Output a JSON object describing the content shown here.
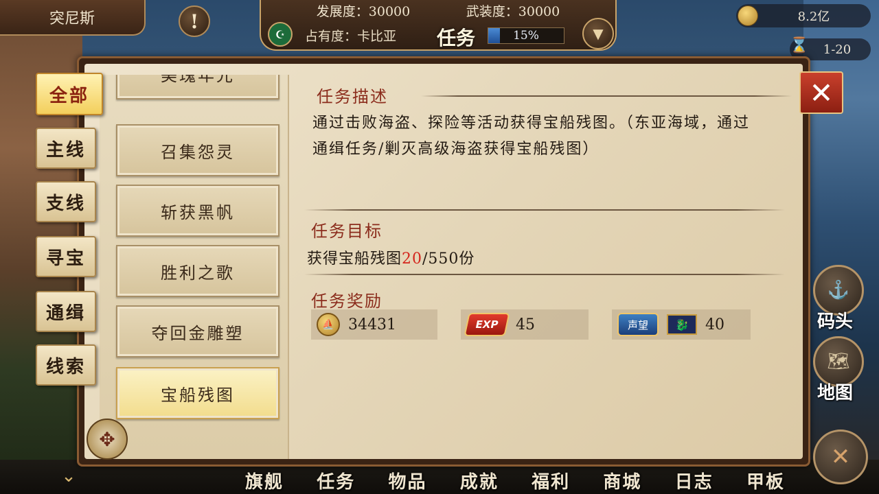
{
  "topbar": {
    "country": "突尼斯",
    "alert": "!",
    "development": "发展度：30000",
    "armament": "武装度：30000",
    "occupancy": "占有度：卡比亚",
    "mission_title": "任务",
    "progress_text": "15%",
    "progress_value": 0.15,
    "gold": "8.2亿",
    "time_range": "1-20"
  },
  "categories": [
    {
      "label": "全部",
      "active": true
    },
    {
      "label": "主线",
      "active": false
    },
    {
      "label": "支线",
      "active": false
    },
    {
      "label": "寻宝",
      "active": false
    },
    {
      "label": "通缉",
      "active": false
    },
    {
      "label": "线索",
      "active": false
    }
  ],
  "quest_list": [
    {
      "label": "美瑰年光",
      "selected": false
    },
    {
      "label": "召集怨灵",
      "selected": false
    },
    {
      "label": "斩获黑帆",
      "selected": false
    },
    {
      "label": "胜利之歌",
      "selected": false
    },
    {
      "label": "夺回金雕塑",
      "selected": false
    },
    {
      "label": "宝船残图",
      "selected": true
    }
  ],
  "detail": {
    "desc_title": "任务描述",
    "desc_text": "通过击败海盗、探险等活动获得宝船残图。（东亚海域，通过通缉任务/剿灭高级海盗获得宝船残图）",
    "goal_title": "任务目标",
    "goal_prefix": "获得宝船残图",
    "goal_current": "20",
    "goal_suffix": "/550份",
    "reward_title": "任务奖励",
    "rewards": {
      "gold": "34431",
      "exp_label": "EXP",
      "exp": "45",
      "reputation_label": "声望",
      "reputation": "40"
    }
  },
  "close_icon": "✕",
  "side_buttons": {
    "dock": "码头",
    "map": "地图"
  },
  "bottom_nav": [
    "旗舰",
    "任务",
    "物品",
    "成就",
    "福利",
    "商城",
    "日志",
    "甲板"
  ],
  "colors": {
    "accent_red": "#8b2c1c",
    "highlight_red": "#d4251c",
    "paper": "#e8dcc0"
  }
}
